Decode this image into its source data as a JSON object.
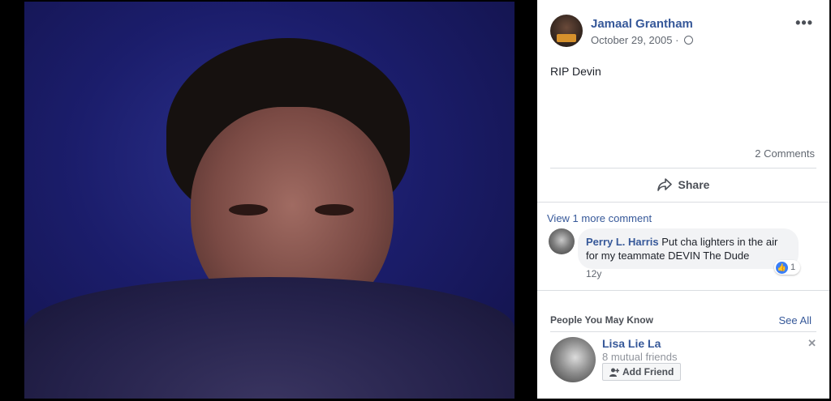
{
  "post": {
    "author": "Jamaal Grantham",
    "date": "October 29, 2005 ·",
    "text": "RIP Devin",
    "comments_count": "2 Comments",
    "share_label": "Share",
    "more_icon": "more-options-icon",
    "privacy_icon": "globe-icon"
  },
  "comments": {
    "view_more": "View 1 more comment",
    "items": [
      {
        "author": "Perry L. Harris",
        "text": "Put cha lighters in the air for my teammate DEVIN The Dude",
        "time": "12y",
        "reactions": "1"
      }
    ]
  },
  "pymk": {
    "title": "People You May Know",
    "see_all": "See All",
    "person": {
      "name": "Lisa Lie La",
      "mutual": "8 mutual friends",
      "add_label": "Add Friend"
    }
  },
  "colors": {
    "link": "#365899",
    "like": "#3b7ff7"
  }
}
